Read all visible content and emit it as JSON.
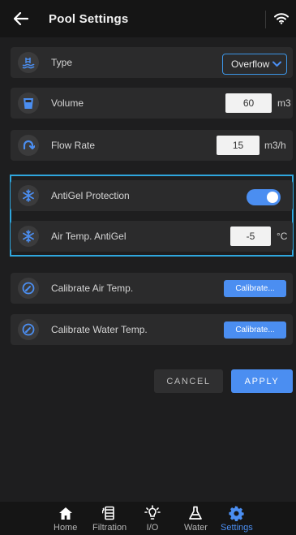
{
  "header": {
    "title": "Pool Settings",
    "back_icon": "arrow-left-icon",
    "wifi_icon": "wifi-icon"
  },
  "rows": {
    "type": {
      "label": "Type",
      "icon": "pool-icon",
      "value": "Overflow"
    },
    "volume": {
      "label": "Volume",
      "icon": "bucket-icon",
      "value": "60",
      "unit": "m3"
    },
    "flow_rate": {
      "label": "Flow Rate",
      "icon": "rotate-arrow-icon",
      "value": "15",
      "unit": "m3/h"
    },
    "antigel": {
      "label": "AntiGel Protection",
      "icon": "snowflake-icon",
      "enabled": true
    },
    "air_temp_antigel": {
      "label": "Air Temp. AntiGel",
      "icon": "snowflake-icon",
      "value": "-5",
      "unit": "°C"
    },
    "calibrate_air": {
      "label": "Calibrate Air Temp.",
      "icon": "gauge-icon",
      "button": "Calibrate..."
    },
    "calibrate_water": {
      "label": "Calibrate Water Temp.",
      "icon": "gauge-icon",
      "button": "Calibrate..."
    }
  },
  "actions": {
    "cancel": "CANCEL",
    "apply": "APPLY"
  },
  "nav": [
    {
      "label": "Home",
      "icon": "home-icon",
      "active": false
    },
    {
      "label": "Filtration",
      "icon": "filter-icon",
      "active": false
    },
    {
      "label": "I/O",
      "icon": "lightbulb-icon",
      "active": false
    },
    {
      "label": "Water",
      "icon": "flask-icon",
      "active": false
    },
    {
      "label": "Settings",
      "icon": "gear-icon",
      "active": true
    }
  ],
  "colors": {
    "accent": "#4b8ef1",
    "highlight_border": "#2fa6dd",
    "background": "#1e1e1f",
    "row": "#2b2b2c"
  }
}
